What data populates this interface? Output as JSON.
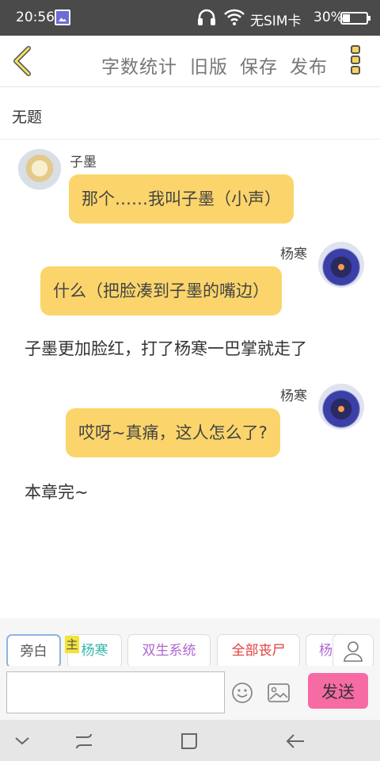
{
  "status_bar": {
    "time": "20:56",
    "carrier": "无SIM卡",
    "battery_percent": "30%",
    "battery_level": 0.3
  },
  "toolbar": {
    "word_count": "字数统计",
    "old_version": "旧版",
    "save": "保存",
    "publish": "发布"
  },
  "document": {
    "title": "无题"
  },
  "messages": [
    {
      "type": "left",
      "speaker": "子墨",
      "text": "那个……我叫子墨（小声）"
    },
    {
      "type": "right",
      "speaker": "杨寒",
      "text": "什么（把脸凑到子墨的嘴边）"
    },
    {
      "type": "narration",
      "text": "子墨更加脸红，打了杨寒一巴掌就走了"
    },
    {
      "type": "right",
      "speaker": "杨寒",
      "text": "哎呀~真痛，这人怎么了?"
    },
    {
      "type": "narration",
      "text": "本章完~"
    }
  ],
  "character_chips": {
    "narrator": "旁白",
    "host_tag": "主",
    "yanghan": "杨寒",
    "shuangsheng": "双生系统",
    "zombie": "全部丧尸",
    "partial": "杨"
  },
  "composer": {
    "input_value": "",
    "send": "发送"
  },
  "colors": {
    "bubble": "#fbd56b",
    "send_button": "#f76ba4",
    "chip_teal": "#37b7a8",
    "chip_purple": "#b067d0",
    "chip_red": "#e0403a"
  },
  "icons": [
    "back-chevron-icon",
    "more-icon",
    "emoji-icon",
    "image-icon",
    "contact-icon",
    "headset-icon",
    "wifi-icon",
    "gallery-icon"
  ]
}
